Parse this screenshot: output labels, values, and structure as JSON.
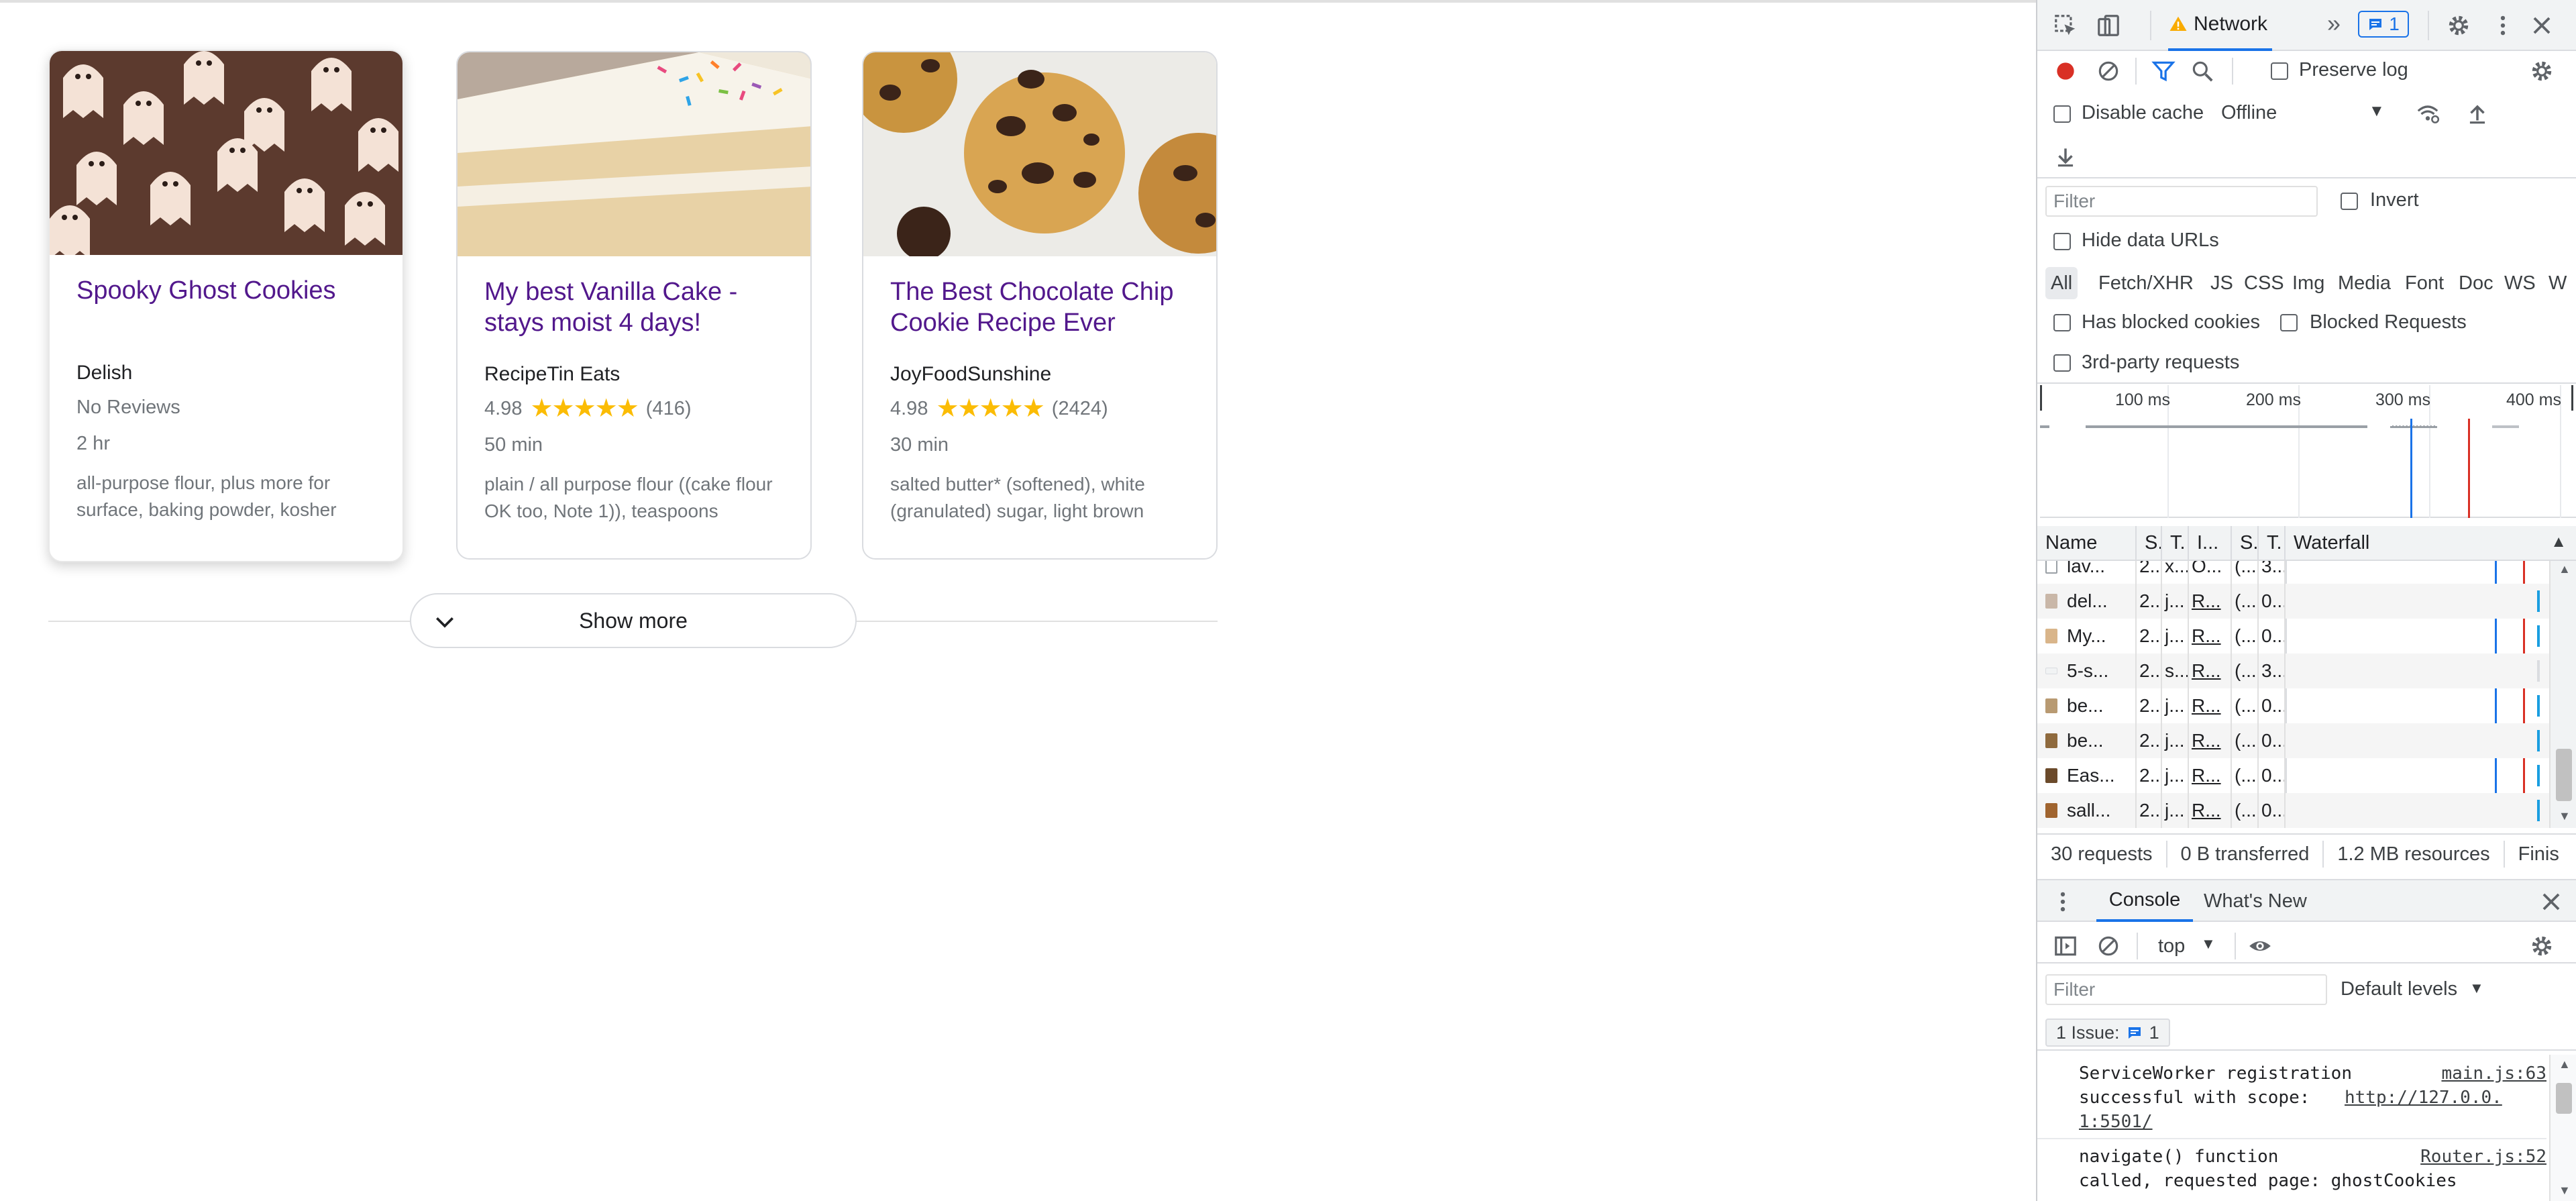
{
  "recipes": [
    {
      "title": "Spooky Ghost Cookies",
      "source": "Delish",
      "reviews_text": "No Reviews",
      "rating": "",
      "rating_count": "",
      "time": "2 hr",
      "ingredients": "all-purpose flour, plus more for surface, baking powder, kosher"
    },
    {
      "title": "My best Vanilla Cake - stays moist 4 days!",
      "source": "RecipeTin Eats",
      "rating": "4.98",
      "stars": "★★★★★",
      "rating_count": "(416)",
      "time": "50 min",
      "ingredients": "plain / all purpose flour ((cake flour OK too, Note 1)), teaspoons"
    },
    {
      "title": "The Best Chocolate Chip Cookie Recipe Ever",
      "source": "JoyFoodSunshine",
      "rating": "4.98",
      "stars": "★★★★★",
      "rating_count": "(2424)",
      "time": "30 min",
      "ingredients": "salted butter* (softened), white (granulated) sugar, light brown"
    }
  ],
  "show_more_label": "Show more",
  "devtools": {
    "tabs": {
      "network": "Network",
      "more": "»",
      "issues_count": "1"
    },
    "toolbar": {
      "preserve_log": "Preserve log",
      "disable_cache": "Disable cache",
      "throttling": "Offline",
      "filter_placeholder": "Filter",
      "invert": "Invert",
      "hide_data_urls": "Hide data URLs",
      "has_blocked_cookies": "Has blocked cookies",
      "blocked_requests": "Blocked Requests",
      "third_party": "3rd-party requests"
    },
    "type_filters": [
      "All",
      "Fetch/XHR",
      "JS",
      "CSS",
      "Img",
      "Media",
      "Font",
      "Doc",
      "WS",
      "W"
    ],
    "timeline_ticks": [
      "100 ms",
      "200 ms",
      "300 ms",
      "400 ms"
    ],
    "columns": [
      "Name",
      "S.",
      "T.",
      "I...",
      "S.",
      "T.",
      "Waterfall"
    ],
    "requests": [
      {
        "name": "lav...",
        "status": "2...",
        "type": "x...",
        "initiator": "O...",
        "size": "(...",
        "time": "3..."
      },
      {
        "name": "del...",
        "status": "2...",
        "type": "j...",
        "initiator": "R...",
        "size": "(...",
        "time": "0..."
      },
      {
        "name": "My...",
        "status": "2...",
        "type": "j...",
        "initiator": "R...",
        "size": "(...",
        "time": "0..."
      },
      {
        "name": "5-s...",
        "status": "2...",
        "type": "s...",
        "initiator": "R...",
        "size": "(...",
        "time": "3..."
      },
      {
        "name": "be...",
        "status": "2...",
        "type": "j...",
        "initiator": "R...",
        "size": "(...",
        "time": "0..."
      },
      {
        "name": "be...",
        "status": "2...",
        "type": "j...",
        "initiator": "R...",
        "size": "(...",
        "time": "0..."
      },
      {
        "name": "Eas...",
        "status": "2...",
        "type": "j...",
        "initiator": "R...",
        "size": "(...",
        "time": "0..."
      },
      {
        "name": "sall...",
        "status": "2...",
        "type": "j...",
        "initiator": "R...",
        "size": "(...",
        "time": "0..."
      }
    ],
    "status_bar": {
      "requests": "30 requests",
      "transferred": "0 B transferred",
      "resources": "1.2 MB resources",
      "finish": "Finis"
    },
    "drawer": {
      "console_tab": "Console",
      "whats_new_tab": "What's New",
      "context": "top",
      "filter_placeholder": "Filter",
      "levels": "Default levels",
      "issues_label": "1 Issue:",
      "issues_count": "1",
      "messages": [
        {
          "text_line1": "ServiceWorker registration",
          "text_line2": "successful with scope:",
          "link1": "http://127.0.0.",
          "link2": "1:5501/",
          "source": "main.js:63"
        },
        {
          "text_line1": "navigate() function",
          "text_line2": "called, requested page: ghostCookies",
          "source": "Router.js:52"
        }
      ]
    }
  }
}
